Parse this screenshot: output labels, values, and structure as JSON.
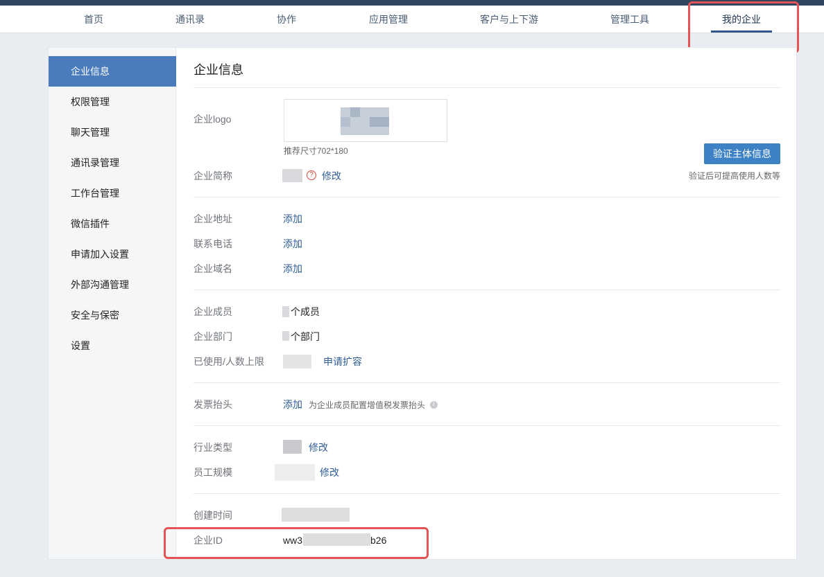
{
  "nav": {
    "items": [
      {
        "label": "首页"
      },
      {
        "label": "通讯录"
      },
      {
        "label": "协作"
      },
      {
        "label": "应用管理"
      },
      {
        "label": "客户与上下游"
      },
      {
        "label": "管理工具"
      },
      {
        "label": "我的企业"
      }
    ],
    "active": "我的企业"
  },
  "sidebar": {
    "items": [
      {
        "label": "企业信息"
      },
      {
        "label": "权限管理"
      },
      {
        "label": "聊天管理"
      },
      {
        "label": "通讯录管理"
      },
      {
        "label": "工作台管理"
      },
      {
        "label": "微信插件"
      },
      {
        "label": "申请加入设置"
      },
      {
        "label": "外部沟通管理"
      },
      {
        "label": "安全与保密"
      },
      {
        "label": "设置"
      }
    ],
    "active": "企业信息"
  },
  "main": {
    "title": "企业信息",
    "logo": {
      "label": "企业logo",
      "hint": "推荐尺寸702*180"
    },
    "verify": {
      "button": "验证主体信息",
      "note": "验证后可提高使用人数等"
    },
    "short_name": {
      "label": "企业简称",
      "help_icon": "?",
      "edit": "修改"
    },
    "address": {
      "label": "企业地址",
      "action": "添加"
    },
    "phone": {
      "label": "联系电话",
      "action": "添加"
    },
    "domain": {
      "label": "企业域名",
      "action": "添加"
    },
    "members": {
      "label": "企业成员",
      "suffix": "个成员"
    },
    "departments": {
      "label": "企业部门",
      "suffix": "个部门"
    },
    "limit": {
      "label": "已使用/人数上限",
      "action": "申请扩容"
    },
    "invoice": {
      "label": "发票抬头",
      "action": "添加",
      "hint": "为企业成员配置增值税发票抬头",
      "info_icon": "i"
    },
    "industry": {
      "label": "行业类型",
      "edit": "修改"
    },
    "scale": {
      "label": "员工规模",
      "edit": "修改"
    },
    "created": {
      "label": "创建时间"
    },
    "corp_id": {
      "label": "企业ID",
      "prefix": "ww3",
      "suffix": "b26"
    }
  },
  "colors": {
    "accent": "#4a7bbc",
    "button": "#3d82c4",
    "link": "#2f5d95",
    "highlight_box": "#e45454",
    "top_bar": "#2f4560"
  }
}
